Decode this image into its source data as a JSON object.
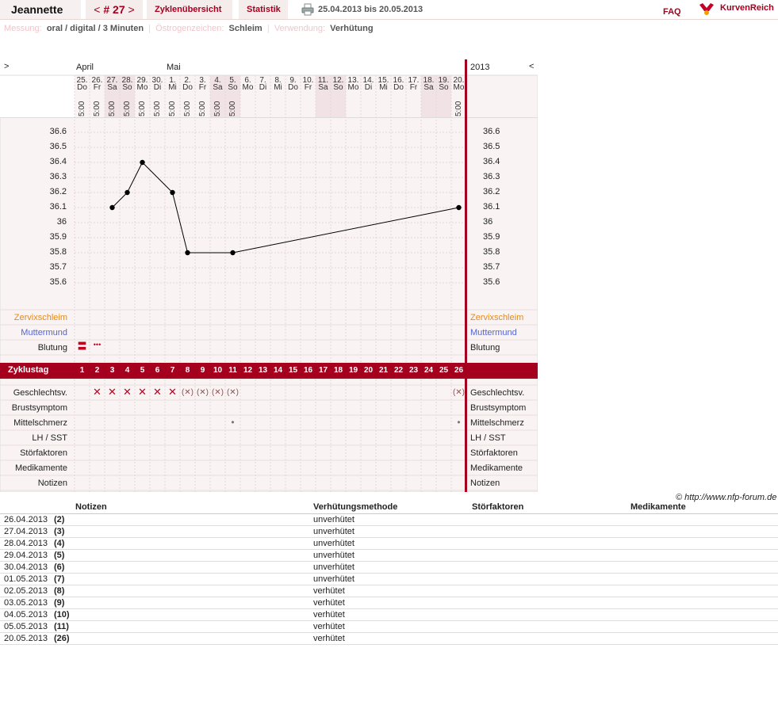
{
  "header": {
    "user_name": "Jeannette",
    "cycle_prefix": "< ",
    "cycle_number": "# 27",
    "cycle_suffix": " >",
    "cycle_overview": "Zyklenübersicht",
    "statistics": "Statistik",
    "date_range": "25.04.2013 bis 20.05.2013",
    "faq": "FAQ",
    "logo_text": "KurvenReich"
  },
  "meta": {
    "measure_label": "Messung:",
    "measure_value": "oral / digital / 3 Minuten",
    "estrogen_label": "Östrogenzeichen:",
    "estrogen_value": "Schleim",
    "use_label": "Verwendung:",
    "use_value": "Verhütung"
  },
  "chart_header": {
    "nav_left": ">",
    "nav_right": "<",
    "year": "2013",
    "month_april": "April",
    "month_mai": "Mai"
  },
  "colors": {
    "accent": "#a5001e",
    "weekend": "#f1e2e6",
    "grid_bg": "#f9f3f3",
    "schleim": "#e58a1a",
    "muttermund": "#5566cc"
  },
  "days": [
    {
      "d": "25.",
      "w": "Do",
      "t": "5:00",
      "we": false
    },
    {
      "d": "26.",
      "w": "Fr",
      "t": "5:00",
      "we": false
    },
    {
      "d": "27.",
      "w": "Sa",
      "t": "5:00",
      "we": true
    },
    {
      "d": "28.",
      "w": "So",
      "t": "5:00",
      "we": true
    },
    {
      "d": "29.",
      "w": "Mo",
      "t": "5:00",
      "we": false
    },
    {
      "d": "30.",
      "w": "Di",
      "t": "5:00",
      "we": false
    },
    {
      "d": "1.",
      "w": "Mi",
      "t": "5:00",
      "we": false
    },
    {
      "d": "2.",
      "w": "Do",
      "t": "5:00",
      "we": false
    },
    {
      "d": "3.",
      "w": "Fr",
      "t": "5:00",
      "we": false
    },
    {
      "d": "4.",
      "w": "Sa",
      "t": "5:00",
      "we": true
    },
    {
      "d": "5.",
      "w": "So",
      "t": "5:00",
      "we": true
    },
    {
      "d": "6.",
      "w": "Mo",
      "t": "",
      "we": false
    },
    {
      "d": "7.",
      "w": "Di",
      "t": "",
      "we": false
    },
    {
      "d": "8.",
      "w": "Mi",
      "t": "",
      "we": false
    },
    {
      "d": "9.",
      "w": "Do",
      "t": "",
      "we": false
    },
    {
      "d": "10.",
      "w": "Fr",
      "t": "",
      "we": false
    },
    {
      "d": "11.",
      "w": "Sa",
      "t": "",
      "we": true
    },
    {
      "d": "12.",
      "w": "So",
      "t": "",
      "we": true
    },
    {
      "d": "13.",
      "w": "Mo",
      "t": "",
      "we": false
    },
    {
      "d": "14.",
      "w": "Di",
      "t": "",
      "we": false
    },
    {
      "d": "15.",
      "w": "Mi",
      "t": "",
      "we": false
    },
    {
      "d": "16.",
      "w": "Do",
      "t": "",
      "we": false
    },
    {
      "d": "17.",
      "w": "Fr",
      "t": "",
      "we": false
    },
    {
      "d": "18.",
      "w": "Sa",
      "t": "",
      "we": true
    },
    {
      "d": "19.",
      "w": "So",
      "t": "",
      "we": true
    },
    {
      "d": "20.",
      "w": "Mo",
      "t": "5:00",
      "we": false
    }
  ],
  "chart_data": {
    "type": "line",
    "y_ticks": [
      "36.6",
      "36.5",
      "36.4",
      "36.3",
      "36.2",
      "36.1",
      "36",
      "35.9",
      "35.8",
      "35.7",
      "35.6"
    ],
    "ylim": [
      35.6,
      36.6
    ],
    "x": [
      3,
      4,
      5,
      7,
      8,
      11,
      26
    ],
    "y": [
      36.1,
      36.2,
      36.4,
      36.2,
      35.8,
      35.8,
      36.1
    ],
    "x_label_row": "Zyklustag",
    "cycle_days": [
      "1",
      "2",
      "3",
      "4",
      "5",
      "6",
      "7",
      "8",
      "9",
      "10",
      "11",
      "12",
      "13",
      "14",
      "15",
      "16",
      "17",
      "18",
      "19",
      "20",
      "21",
      "22",
      "23",
      "24",
      "25",
      "26"
    ]
  },
  "rows": {
    "zervixschleim": "Zervixschleim",
    "muttermund": "Muttermund",
    "blutung": "Blutung",
    "zyklustag": "Zyklustag",
    "geschlechtsv": "Geschlechtsv.",
    "brustsymptom": "Brustsymptom",
    "mittelschmerz": "Mittelschmerz",
    "lh_sst": "LH / SST",
    "stoerfaktoren": "Störfaktoren",
    "medikamente": "Medikamente",
    "notizen": "Notizen"
  },
  "marks": {
    "blutung_strong_day": 1,
    "blutung_light_day": 2,
    "blutung_strong_symbol": "〓",
    "blutung_light_symbol": "•••",
    "sex_unprotected_days": [
      2,
      3,
      4,
      5,
      6,
      7
    ],
    "sex_protected_days": [
      8,
      9,
      10,
      11,
      26
    ],
    "sex_unprotected_symbol": "✕",
    "sex_protected_symbol": "(✕)",
    "mittelschmerz_days": [
      11,
      26
    ],
    "mittelschmerz_symbol": "•"
  },
  "copyright": "© http://www.nfp-forum.de",
  "table": {
    "headers": {
      "notizen": "Notizen",
      "methode": "Verhütungsmethode",
      "stoer": "Störfaktoren",
      "medi": "Medikamente"
    },
    "rows": [
      {
        "date": "26.04.2013",
        "day": "(2)",
        "method": "unverhütet"
      },
      {
        "date": "27.04.2013",
        "day": "(3)",
        "method": "unverhütet"
      },
      {
        "date": "28.04.2013",
        "day": "(4)",
        "method": "unverhütet"
      },
      {
        "date": "29.04.2013",
        "day": "(5)",
        "method": "unverhütet"
      },
      {
        "date": "30.04.2013",
        "day": "(6)",
        "method": "unverhütet"
      },
      {
        "date": "01.05.2013",
        "day": "(7)",
        "method": "unverhütet"
      },
      {
        "date": "02.05.2013",
        "day": "(8)",
        "method": "verhütet"
      },
      {
        "date": "03.05.2013",
        "day": "(9)",
        "method": "verhütet"
      },
      {
        "date": "04.05.2013",
        "day": "(10)",
        "method": "verhütet"
      },
      {
        "date": "05.05.2013",
        "day": "(11)",
        "method": "verhütet"
      },
      {
        "date": "20.05.2013",
        "day": "(26)",
        "method": "verhütet"
      }
    ]
  }
}
